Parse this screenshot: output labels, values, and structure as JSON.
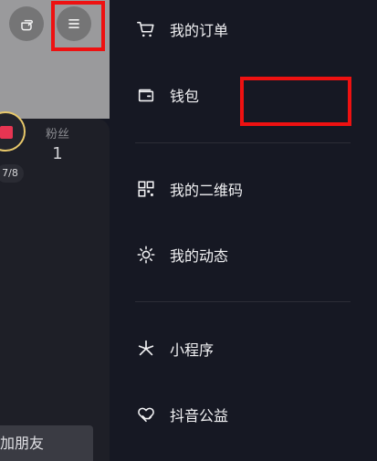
{
  "profile": {
    "fans_label": "粉丝",
    "fans_count": "1",
    "badge_count": "7/8",
    "add_friend_label": "加朋友"
  },
  "drawer": {
    "items": [
      {
        "label": "我的订单",
        "icon": "shopping-cart-icon"
      },
      {
        "label": "钱包",
        "icon": "wallet-icon"
      },
      {
        "label": "我的二维码",
        "icon": "qr-code-icon"
      },
      {
        "label": "我的动态",
        "icon": "sun-dashed-icon"
      },
      {
        "label": "小程序",
        "icon": "asterisk-icon"
      },
      {
        "label": "抖音公益",
        "icon": "heart-hands-icon"
      }
    ]
  },
  "colors": {
    "background": "#161823",
    "highlight": "#ee1111",
    "text": "#f2f2f4"
  }
}
